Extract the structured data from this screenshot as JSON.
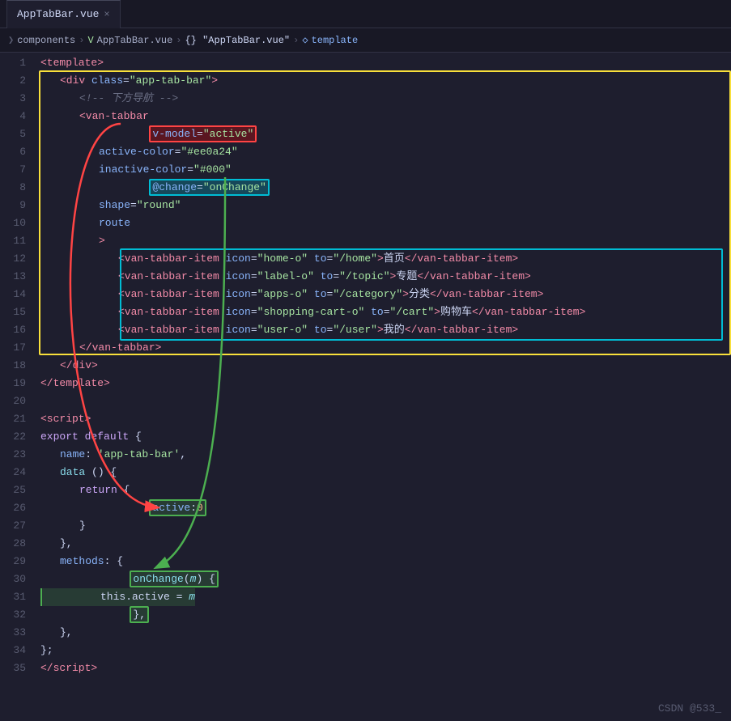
{
  "tab": {
    "filename": "AppTabBar.vue",
    "close_label": "×"
  },
  "breadcrumb": {
    "items": [
      {
        "label": "components",
        "type": "plain"
      },
      {
        "label": ">",
        "type": "sep"
      },
      {
        "label": "AppTabBar.vue",
        "type": "vue"
      },
      {
        "label": ">",
        "type": "sep"
      },
      {
        "label": "{}",
        "type": "obj"
      },
      {
        "label": "\"AppTabBar.vue\"",
        "type": "obj"
      },
      {
        "label": ">",
        "type": "sep"
      },
      {
        "label": "template",
        "type": "template"
      }
    ]
  },
  "lines": [
    {
      "num": 1,
      "content": "template_open"
    },
    {
      "num": 2,
      "content": "div_open"
    },
    {
      "num": 3,
      "content": "comment"
    },
    {
      "num": 4,
      "content": "van_tabbar_open"
    },
    {
      "num": 5,
      "content": "vmodel"
    },
    {
      "num": 6,
      "content": "active_color"
    },
    {
      "num": 7,
      "content": "inactive_color"
    },
    {
      "num": 8,
      "content": "at_change"
    },
    {
      "num": 9,
      "content": "shape"
    },
    {
      "num": 10,
      "content": "route"
    },
    {
      "num": 11,
      "content": "gt"
    },
    {
      "num": 12,
      "content": "item_home"
    },
    {
      "num": 13,
      "content": "item_topic"
    },
    {
      "num": 14,
      "content": "item_category"
    },
    {
      "num": 15,
      "content": "item_cart"
    },
    {
      "num": 16,
      "content": "item_user"
    },
    {
      "num": 17,
      "content": "van_tabbar_close"
    },
    {
      "num": 18,
      "content": "div_close"
    },
    {
      "num": 19,
      "content": "template_close"
    },
    {
      "num": 20,
      "content": "blank"
    },
    {
      "num": 21,
      "content": "script_open"
    },
    {
      "num": 22,
      "content": "export_default"
    },
    {
      "num": 23,
      "content": "name"
    },
    {
      "num": 24,
      "content": "data_fn"
    },
    {
      "num": 25,
      "content": "return_open"
    },
    {
      "num": 26,
      "content": "active_zero"
    },
    {
      "num": 27,
      "content": "return_close"
    },
    {
      "num": 28,
      "content": "data_close"
    },
    {
      "num": 29,
      "content": "methods_open"
    },
    {
      "num": 30,
      "content": "onchange_fn"
    },
    {
      "num": 31,
      "content": "this_active"
    },
    {
      "num": 32,
      "content": "fn_close"
    },
    {
      "num": 33,
      "content": "methods_close"
    },
    {
      "num": 34,
      "content": "obj_close"
    },
    {
      "num": 35,
      "content": "script_close"
    }
  ],
  "watermark": "CSDN @533_"
}
